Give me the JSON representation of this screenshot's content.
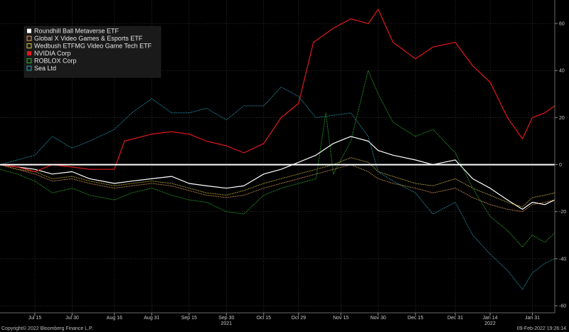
{
  "chart_data": {
    "type": "line",
    "title": "",
    "xlabel": "",
    "ylabel": "",
    "ylim": [
      -63,
      70
    ],
    "y_ticks": [
      60,
      40,
      20,
      0,
      -20,
      -40,
      -60
    ],
    "y_axis_side": "right",
    "grid": true,
    "legend_position": "top-left",
    "x_ticks": [
      {
        "label": "Jul 15",
        "x": "2021-07-15"
      },
      {
        "label": "Jul 30",
        "x": "2021-07-30"
      },
      {
        "label": "Aug 16",
        "x": "2021-08-16"
      },
      {
        "label": "Aug 31",
        "x": "2021-08-31"
      },
      {
        "label": "Sep 15",
        "x": "2021-09-15"
      },
      {
        "label": "Sep 30",
        "x": "2021-09-30"
      },
      {
        "label": "Oct 15",
        "x": "2021-10-15"
      },
      {
        "label": "Oct 29",
        "x": "2021-10-29"
      },
      {
        "label": "Nov 15",
        "x": "2021-11-15"
      },
      {
        "label": "Nov 30",
        "x": "2021-11-30"
      },
      {
        "label": "Dec 15",
        "x": "2021-12-15"
      },
      {
        "label": "Dec 31",
        "x": "2021-12-31"
      },
      {
        "label": "Jan 14",
        "x": "2022-01-14"
      },
      {
        "label": "Jan 31",
        "x": "2022-01-31"
      }
    ],
    "year_labels": [
      {
        "label": "2021",
        "x": "2021-09-30"
      },
      {
        "label": "2022",
        "x": "2022-01-14"
      }
    ],
    "x_range": [
      "2021-07-01",
      "2022-02-09"
    ],
    "baseline": 0,
    "series": [
      {
        "name": "Roundhill Ball Metaverse ETF",
        "color": "#ffffff",
        "dash": "solid",
        "marker": "filled",
        "points": [
          [
            "2021-07-01",
            0
          ],
          [
            "2021-07-08",
            -1
          ],
          [
            "2021-07-15",
            -2
          ],
          [
            "2021-07-22",
            -4
          ],
          [
            "2021-07-30",
            -3
          ],
          [
            "2021-08-06",
            -6
          ],
          [
            "2021-08-16",
            -8
          ],
          [
            "2021-08-23",
            -7
          ],
          [
            "2021-08-31",
            -6
          ],
          [
            "2021-09-08",
            -5
          ],
          [
            "2021-09-15",
            -8
          ],
          [
            "2021-09-22",
            -9
          ],
          [
            "2021-09-30",
            -10
          ],
          [
            "2021-10-07",
            -9
          ],
          [
            "2021-10-15",
            -4
          ],
          [
            "2021-10-22",
            -2
          ],
          [
            "2021-10-29",
            1
          ],
          [
            "2021-11-05",
            4
          ],
          [
            "2021-11-12",
            9
          ],
          [
            "2021-11-19",
            12
          ],
          [
            "2021-11-26",
            10
          ],
          [
            "2021-11-30",
            6
          ],
          [
            "2021-12-06",
            4
          ],
          [
            "2021-12-15",
            2
          ],
          [
            "2021-12-22",
            0
          ],
          [
            "2021-12-31",
            2
          ],
          [
            "2022-01-07",
            -6
          ],
          [
            "2022-01-14",
            -10
          ],
          [
            "2022-01-21",
            -15
          ],
          [
            "2022-01-27",
            -19
          ],
          [
            "2022-01-31",
            -16
          ],
          [
            "2022-02-05",
            -17
          ],
          [
            "2022-02-09",
            -15
          ]
        ]
      },
      {
        "name": "Global X Video Games & Esports ETF",
        "color": "#e9a35c",
        "dash": "dot",
        "marker": "outline",
        "points": [
          [
            "2021-07-01",
            0
          ],
          [
            "2021-07-08",
            -2
          ],
          [
            "2021-07-15",
            -4
          ],
          [
            "2021-07-22",
            -7
          ],
          [
            "2021-07-30",
            -6
          ],
          [
            "2021-08-06",
            -8
          ],
          [
            "2021-08-16",
            -10
          ],
          [
            "2021-08-23",
            -9
          ],
          [
            "2021-08-31",
            -8
          ],
          [
            "2021-09-08",
            -9
          ],
          [
            "2021-09-15",
            -11
          ],
          [
            "2021-09-22",
            -13
          ],
          [
            "2021-09-30",
            -14
          ],
          [
            "2021-10-07",
            -13
          ],
          [
            "2021-10-15",
            -10
          ],
          [
            "2021-10-22",
            -8
          ],
          [
            "2021-10-29",
            -6
          ],
          [
            "2021-11-05",
            -4
          ],
          [
            "2021-11-12",
            -2
          ],
          [
            "2021-11-19",
            0
          ],
          [
            "2021-11-26",
            -3
          ],
          [
            "2021-11-30",
            -6
          ],
          [
            "2021-12-06",
            -8
          ],
          [
            "2021-12-15",
            -10
          ],
          [
            "2021-12-22",
            -12
          ],
          [
            "2021-12-31",
            -10
          ],
          [
            "2022-01-07",
            -14
          ],
          [
            "2022-01-14",
            -17
          ],
          [
            "2022-01-21",
            -19
          ],
          [
            "2022-01-27",
            -20
          ],
          [
            "2022-01-31",
            -17
          ],
          [
            "2022-02-05",
            -16
          ],
          [
            "2022-02-09",
            -15
          ]
        ]
      },
      {
        "name": "Wedbush ETFMG Video Game Tech ETF",
        "color": "#d9c23a",
        "dash": "dot",
        "marker": "outline",
        "points": [
          [
            "2021-07-01",
            0
          ],
          [
            "2021-07-08",
            -2
          ],
          [
            "2021-07-15",
            -3
          ],
          [
            "2021-07-22",
            -6
          ],
          [
            "2021-07-30",
            -5
          ],
          [
            "2021-08-06",
            -7
          ],
          [
            "2021-08-16",
            -9
          ],
          [
            "2021-08-23",
            -8
          ],
          [
            "2021-08-31",
            -7
          ],
          [
            "2021-09-08",
            -8
          ],
          [
            "2021-09-15",
            -10
          ],
          [
            "2021-09-22",
            -12
          ],
          [
            "2021-09-30",
            -13
          ],
          [
            "2021-10-07",
            -11
          ],
          [
            "2021-10-15",
            -8
          ],
          [
            "2021-10-22",
            -6
          ],
          [
            "2021-10-29",
            -4
          ],
          [
            "2021-11-05",
            -2
          ],
          [
            "2021-11-12",
            0
          ],
          [
            "2021-11-19",
            3
          ],
          [
            "2021-11-26",
            1
          ],
          [
            "2021-11-30",
            -3
          ],
          [
            "2021-12-06",
            -5
          ],
          [
            "2021-12-15",
            -8
          ],
          [
            "2021-12-22",
            -9
          ],
          [
            "2021-12-31",
            -6
          ],
          [
            "2022-01-07",
            -10
          ],
          [
            "2022-01-14",
            -13
          ],
          [
            "2022-01-21",
            -16
          ],
          [
            "2022-01-27",
            -18
          ],
          [
            "2022-01-31",
            -14
          ],
          [
            "2022-02-05",
            -13
          ],
          [
            "2022-02-09",
            -12
          ]
        ]
      },
      {
        "name": "NVIDIA Corp",
        "color": "#e0191c",
        "dash": "solid",
        "marker": "filled",
        "points": [
          [
            "2021-07-01",
            0
          ],
          [
            "2021-07-08",
            -1
          ],
          [
            "2021-07-15",
            -3
          ],
          [
            "2021-07-22",
            0
          ],
          [
            "2021-07-30",
            -1
          ],
          [
            "2021-08-06",
            -2
          ],
          [
            "2021-08-16",
            -2
          ],
          [
            "2021-08-20",
            10
          ],
          [
            "2021-08-31",
            13
          ],
          [
            "2021-09-08",
            14
          ],
          [
            "2021-09-15",
            13
          ],
          [
            "2021-09-22",
            10
          ],
          [
            "2021-09-30",
            8
          ],
          [
            "2021-10-07",
            5
          ],
          [
            "2021-10-15",
            9
          ],
          [
            "2021-10-22",
            20
          ],
          [
            "2021-10-29",
            26
          ],
          [
            "2021-11-04",
            52
          ],
          [
            "2021-11-12",
            58
          ],
          [
            "2021-11-19",
            62
          ],
          [
            "2021-11-26",
            60
          ],
          [
            "2021-11-30",
            66
          ],
          [
            "2021-12-06",
            52
          ],
          [
            "2021-12-15",
            45
          ],
          [
            "2021-12-22",
            50
          ],
          [
            "2021-12-31",
            52
          ],
          [
            "2022-01-07",
            42
          ],
          [
            "2022-01-14",
            35
          ],
          [
            "2022-01-21",
            20
          ],
          [
            "2022-01-27",
            11
          ],
          [
            "2022-01-31",
            20
          ],
          [
            "2022-02-05",
            22
          ],
          [
            "2022-02-09",
            25
          ]
        ]
      },
      {
        "name": "ROBLOX Corp",
        "color": "#29b32c",
        "dash": "dot",
        "marker": "outline",
        "points": [
          [
            "2021-07-01",
            -2
          ],
          [
            "2021-07-08",
            -4
          ],
          [
            "2021-07-15",
            -7
          ],
          [
            "2021-07-22",
            -12
          ],
          [
            "2021-07-30",
            -10
          ],
          [
            "2021-08-06",
            -13
          ],
          [
            "2021-08-16",
            -15
          ],
          [
            "2021-08-23",
            -12
          ],
          [
            "2021-08-31",
            -10
          ],
          [
            "2021-09-08",
            -13
          ],
          [
            "2021-09-15",
            -15
          ],
          [
            "2021-09-22",
            -16
          ],
          [
            "2021-09-30",
            -20
          ],
          [
            "2021-10-07",
            -21
          ],
          [
            "2021-10-15",
            -13
          ],
          [
            "2021-10-22",
            -10
          ],
          [
            "2021-10-29",
            -8
          ],
          [
            "2021-11-05",
            -6
          ],
          [
            "2021-11-09",
            22
          ],
          [
            "2021-11-12",
            -4
          ],
          [
            "2021-11-19",
            10
          ],
          [
            "2021-11-26",
            40
          ],
          [
            "2021-11-30",
            30
          ],
          [
            "2021-12-06",
            18
          ],
          [
            "2021-12-15",
            12
          ],
          [
            "2021-12-22",
            15
          ],
          [
            "2021-12-31",
            5
          ],
          [
            "2022-01-07",
            -10
          ],
          [
            "2022-01-14",
            -22
          ],
          [
            "2022-01-21",
            -28
          ],
          [
            "2022-01-27",
            -35
          ],
          [
            "2022-01-31",
            -30
          ],
          [
            "2022-02-05",
            -33
          ],
          [
            "2022-02-09",
            -29
          ]
        ]
      },
      {
        "name": "Sea Ltd",
        "color": "#2aa0bb",
        "dash": "dot",
        "marker": "outline",
        "points": [
          [
            "2021-07-01",
            0
          ],
          [
            "2021-07-08",
            2
          ],
          [
            "2021-07-15",
            4
          ],
          [
            "2021-07-22",
            12
          ],
          [
            "2021-07-30",
            7
          ],
          [
            "2021-08-06",
            10
          ],
          [
            "2021-08-16",
            15
          ],
          [
            "2021-08-23",
            22
          ],
          [
            "2021-08-31",
            28
          ],
          [
            "2021-09-08",
            22
          ],
          [
            "2021-09-15",
            22
          ],
          [
            "2021-09-22",
            24
          ],
          [
            "2021-09-30",
            19
          ],
          [
            "2021-10-07",
            25
          ],
          [
            "2021-10-15",
            25
          ],
          [
            "2021-10-22",
            33
          ],
          [
            "2021-10-29",
            29
          ],
          [
            "2021-11-05",
            20
          ],
          [
            "2021-11-12",
            21
          ],
          [
            "2021-11-19",
            22
          ],
          [
            "2021-11-26",
            12
          ],
          [
            "2021-11-30",
            -3
          ],
          [
            "2021-12-06",
            -7
          ],
          [
            "2021-12-15",
            -12
          ],
          [
            "2021-12-22",
            -21
          ],
          [
            "2021-12-31",
            -16
          ],
          [
            "2022-01-07",
            -30
          ],
          [
            "2022-01-14",
            -38
          ],
          [
            "2022-01-21",
            -45
          ],
          [
            "2022-01-27",
            -53
          ],
          [
            "2022-01-31",
            -46
          ],
          [
            "2022-02-05",
            -42
          ],
          [
            "2022-02-09",
            -40
          ]
        ]
      }
    ]
  },
  "footer": {
    "copyright": "Copyright© 2022 Bloomberg Finance L.P.",
    "timestamp": "09-Feb-2022 19:26:14"
  }
}
